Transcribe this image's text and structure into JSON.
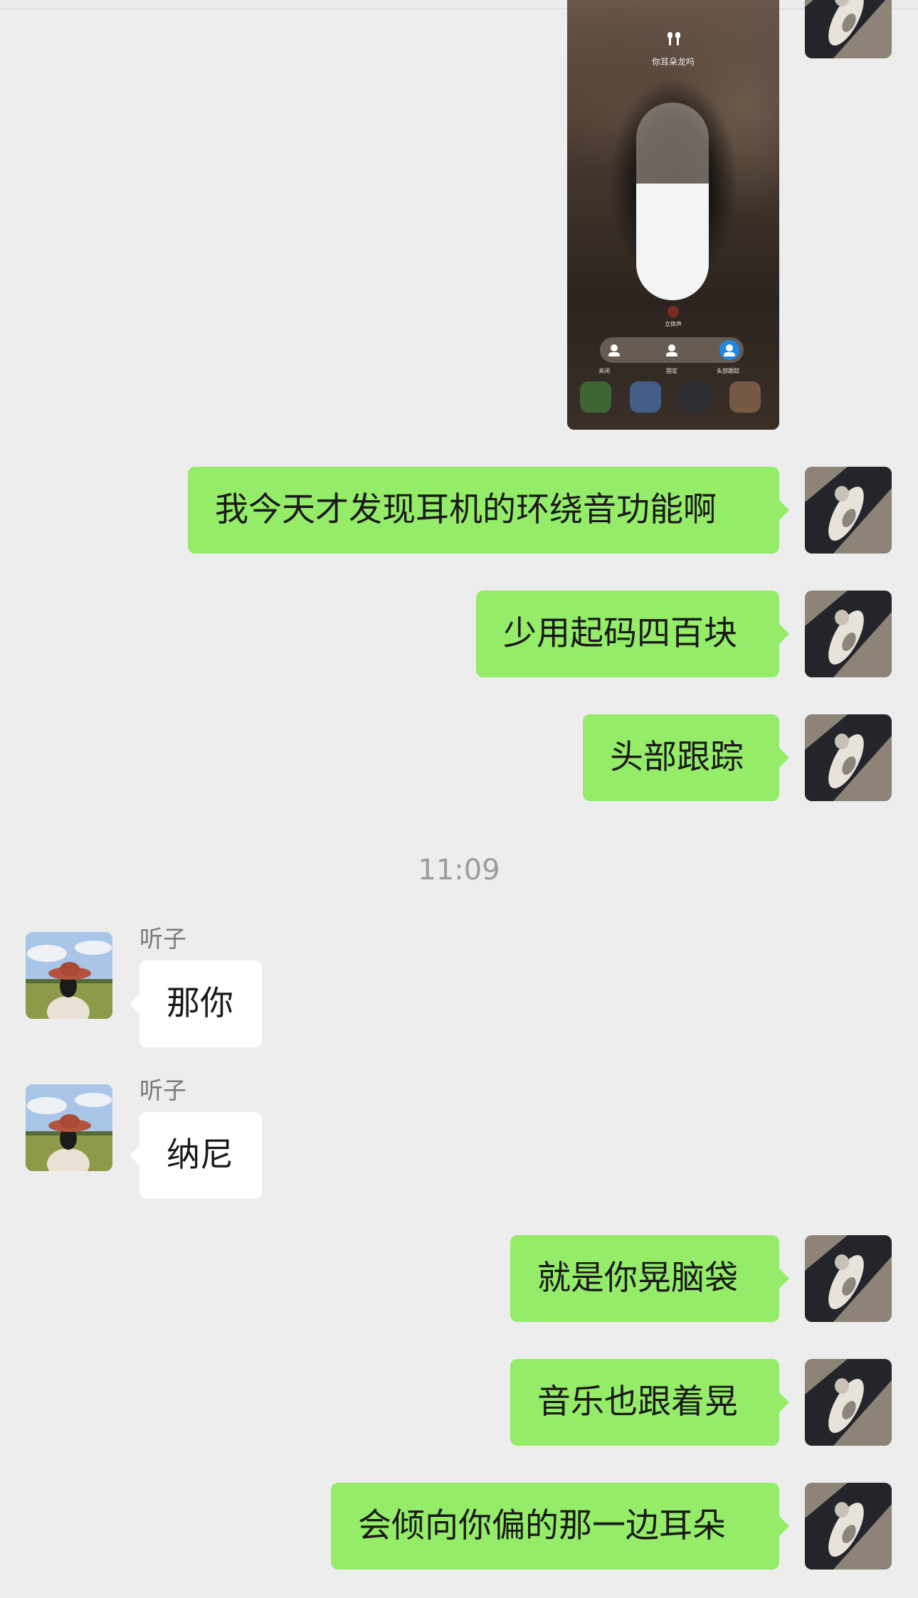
{
  "screenshot": {
    "title": "你耳朵龙吗",
    "footer_label": "立体声",
    "modes": [
      "关闭",
      "固定",
      "头部跟踪"
    ],
    "volume_level_percent": 59
  },
  "me": {
    "avatar_icon": "cat-photo-avatar",
    "messages": [
      "我今天才发现耳机的环绕音功能啊",
      "少用起码四百块",
      "头部跟踪",
      "就是你晃脑袋",
      "音乐也跟着晃",
      "会倾向你偏的那一边耳朵"
    ]
  },
  "time_divider": "11:09",
  "other": {
    "name": "听子",
    "avatar_icon": "woman-in-hat-photo-avatar",
    "messages": [
      "那你",
      "纳尼"
    ]
  },
  "colors": {
    "background": "#ededed",
    "my_bubble": "#95ec69",
    "their_bubble": "#ffffff"
  }
}
